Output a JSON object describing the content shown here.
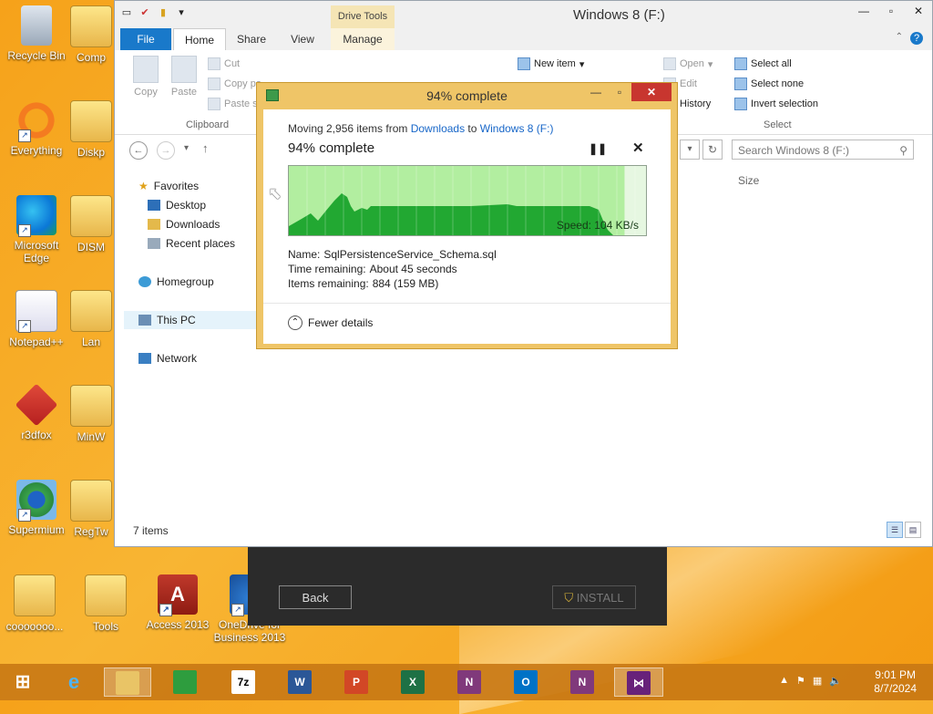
{
  "desktop": {
    "icons": [
      {
        "label": "Recycle Bin"
      },
      {
        "label": "Comp"
      },
      {
        "label": "Everything"
      },
      {
        "label": "Diskp"
      },
      {
        "label": "Microsoft Edge"
      },
      {
        "label": "DISM"
      },
      {
        "label": "Notepad++"
      },
      {
        "label": "Lan"
      },
      {
        "label": "r3dfox"
      },
      {
        "label": "MinW"
      },
      {
        "label": "Supermium"
      },
      {
        "label": "RegTw"
      },
      {
        "label": "cooooooo..."
      },
      {
        "label": "Tools"
      },
      {
        "label": "Access 2013"
      },
      {
        "label": "OneDrive for Business 2013"
      }
    ]
  },
  "explorer": {
    "title": "Windows 8 (F:)",
    "context_tab": "Drive Tools",
    "tabs": [
      "File",
      "Home",
      "Share",
      "View",
      "Manage"
    ],
    "ribbon": {
      "copy": "Copy",
      "paste": "Paste",
      "cut": "Cut",
      "copy_path": "Copy pa",
      "paste_shortcut": "Paste s",
      "new_item": "New item",
      "open": "Open",
      "edit": "Edit",
      "history": "History",
      "select_all": "Select all",
      "select_none": "Select none",
      "invert_selection": "Invert selection",
      "group_clipboard": "Clipboard",
      "group_select": "Select"
    },
    "search_placeholder": "Search Windows 8 (F:)",
    "nav": {
      "favorites": "Favorites",
      "desktop": "Desktop",
      "downloads": "Downloads",
      "recent": "Recent places",
      "homegroup": "Homegroup",
      "this_pc": "This PC",
      "network": "Network"
    },
    "column_size": "Size",
    "status": "7 items"
  },
  "progress_dialog": {
    "title": "94% complete",
    "moving_prefix": "Moving 2,956 items from ",
    "source": "Downloads",
    "to_word": " to ",
    "destination": "Windows 8 (F:)",
    "heading": "94% complete",
    "percent": 94,
    "speed": "Speed: 104 KB/s",
    "name_label": "Name:",
    "name_value": "SqlPersistenceService_Schema.sql",
    "time_label": "Time remaining:",
    "time_value": "About 45 seconds",
    "items_label": "Items remaining:",
    "items_value": "884 (159 MB)",
    "fewer_details": "Fewer details"
  },
  "installer": {
    "back": "Back",
    "install": "INSTALL"
  },
  "taskbar": {
    "apps": [
      "Internet Explorer",
      "File Explorer",
      "Store",
      "7-Zip",
      "Word",
      "PowerPoint",
      "Excel",
      "OneNote",
      "Outlook",
      "OneNote",
      "Visual Studio"
    ],
    "time": "9:01 PM",
    "date": "8/7/2024"
  },
  "colors": {
    "accent": "#1979ca",
    "dialog_frame": "#efc567",
    "graph_fill": "#22a832",
    "graph_bg": "#b2eea0"
  }
}
